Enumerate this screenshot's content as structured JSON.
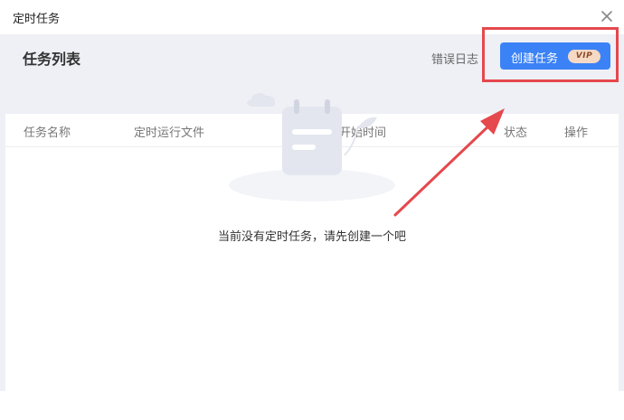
{
  "dialog": {
    "title": "定时任务"
  },
  "header": {
    "title": "任务列表",
    "error_log": "错误日志",
    "create_button": "创建任务",
    "vip_badge": "VIP"
  },
  "table": {
    "columns": [
      "任务名称",
      "定时运行文件",
      "开始时间",
      "状态",
      "操作"
    ],
    "rows": []
  },
  "empty_state": {
    "message": "当前没有定时任务，请先创建一个吧"
  },
  "colors": {
    "accent": "#3b82f6",
    "highlight": "#e5484d",
    "background": "#eef0f5"
  },
  "icons": [
    "close-icon",
    "notebook-icon",
    "cloud-icon",
    "leaf-icon",
    "arrow-annotation"
  ]
}
